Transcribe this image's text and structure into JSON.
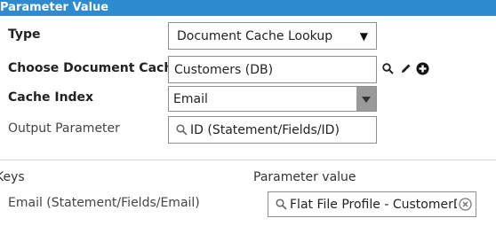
{
  "header": {
    "title": "Parameter Value"
  },
  "form": {
    "type_label": "Type",
    "type_value": "Document Cache Lookup",
    "cache_label": "Choose Document Cache",
    "cache_value": "Customers (DB)",
    "index_label": "Cache Index",
    "index_value": "Email",
    "output_label": "Output Parameter",
    "output_value": "ID (Statement/Fields/ID)"
  },
  "keys": {
    "col_keys": "Keys",
    "col_value": "Parameter value",
    "rows": [
      {
        "key": "Email (Statement/Fields/Email)",
        "value": "Flat File Profile - CustomerD"
      }
    ]
  },
  "icons": [
    "search-icon",
    "pencil-icon",
    "plus-circle-icon",
    "chevron-down-icon",
    "clear-icon"
  ],
  "colors": {
    "header_bg": "#2e8bd0",
    "border": "#8f8f8f",
    "dropdown_button": "#9a9a9a"
  }
}
